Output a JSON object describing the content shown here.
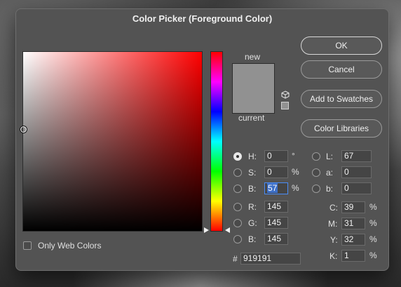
{
  "window": {
    "title": "Color Picker (Foreground Color)"
  },
  "buttons": {
    "ok": "OK",
    "cancel": "Cancel",
    "add_to_swatches": "Add to Swatches",
    "color_libraries": "Color Libraries"
  },
  "swatch": {
    "new_label": "new",
    "current_label": "current",
    "color": "#919191"
  },
  "hsb": {
    "h": {
      "label": "H:",
      "value": "0",
      "unit": "°"
    },
    "s": {
      "label": "S:",
      "value": "0",
      "unit": "%"
    },
    "b": {
      "label": "B:",
      "value": "57",
      "unit": "%"
    }
  },
  "rgb": {
    "r": {
      "label": "R:",
      "value": "145"
    },
    "g": {
      "label": "G:",
      "value": "145"
    },
    "b": {
      "label": "B:",
      "value": "145"
    }
  },
  "lab": {
    "l": {
      "label": "L:",
      "value": "67"
    },
    "a": {
      "label": "a:",
      "value": "0"
    },
    "b": {
      "label": "b:",
      "value": "0"
    }
  },
  "cmyk": {
    "c": {
      "label": "C:",
      "value": "39",
      "unit": "%"
    },
    "m": {
      "label": "M:",
      "value": "31",
      "unit": "%"
    },
    "y": {
      "label": "Y:",
      "value": "32",
      "unit": "%"
    },
    "k": {
      "label": "K:",
      "value": "1",
      "unit": "%"
    }
  },
  "hex": {
    "label": "#",
    "value": "919191"
  },
  "options": {
    "only_web_colors": "Only Web Colors",
    "only_web_colors_checked": false
  },
  "selected_radio": "H",
  "hue_degrees": 0
}
